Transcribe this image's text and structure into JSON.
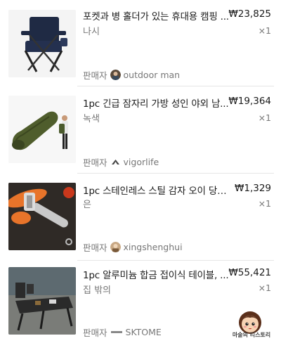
{
  "items": [
    {
      "title": "포켓과 병 홀더가 있는 휴대용 캠핑 ...",
      "price": "₩23,825",
      "option": "나시",
      "quantity": "×1",
      "seller_label": "판매자",
      "seller_name": "outdoor man",
      "image_icon": "camping-chair"
    },
    {
      "title": "1pc 긴급 잠자리 가방 성인 야외 남...",
      "price": "₩19,364",
      "option": "녹색",
      "quantity": "×1",
      "seller_label": "판매자",
      "seller_name": "vigorlife",
      "image_icon": "sleeping-bag"
    },
    {
      "title": "1pc 스테인레스 스틸 감자 오이 당근 ...",
      "price": "₩1,329",
      "option": "은",
      "quantity": "×1",
      "seller_label": "판매자",
      "seller_name": "xingshenghui",
      "image_icon": "vegetable-peeler"
    },
    {
      "title": "1pc 알루미늄 합금 접이식 테이블, ...",
      "price": "₩55,421",
      "option": "집 밖의",
      "quantity": "×1",
      "seller_label": "판매자",
      "seller_name": "SKTOME",
      "image_icon": "folding-table"
    }
  ],
  "watermark": {
    "text": "마술의 티스토리",
    "icon": "cartoon-girl-face"
  },
  "colors": {
    "text_primary": "#1a1a1a",
    "text_secondary": "#777777",
    "divider": "#e6e6e6"
  }
}
